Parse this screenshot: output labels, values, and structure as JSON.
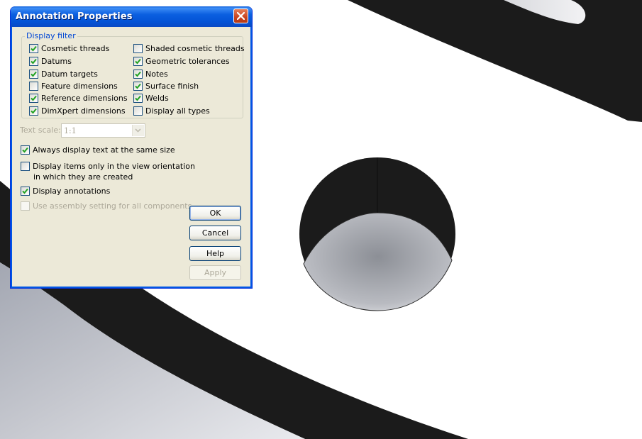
{
  "dialog": {
    "title": "Annotation Properties",
    "display_filter_label": "Display filter",
    "filters": [
      {
        "label": "Cosmetic threads",
        "checked": true
      },
      {
        "label": "Shaded cosmetic threads",
        "checked": false
      },
      {
        "label": "Datums",
        "checked": true
      },
      {
        "label": "Geometric tolerances",
        "checked": true
      },
      {
        "label": "Datum targets",
        "checked": true
      },
      {
        "label": "Notes",
        "checked": true
      },
      {
        "label": "Feature dimensions",
        "checked": false
      },
      {
        "label": "Surface finish",
        "checked": true
      },
      {
        "label": "Reference dimensions",
        "checked": true
      },
      {
        "label": "Welds",
        "checked": true
      },
      {
        "label": "DimXpert dimensions",
        "checked": true
      },
      {
        "label": "Display all types",
        "checked": false
      }
    ],
    "text_scale_label": "Text scale:",
    "text_scale_value": "1:1",
    "options": {
      "same_size": {
        "label": "Always display text at the same size",
        "checked": true
      },
      "view_orientation": {
        "label_line1": "Display items only in the view orientation",
        "label_line2": "in which they are created",
        "checked": false
      },
      "display_annotations": {
        "label": "Display annotations",
        "checked": true
      },
      "assembly_setting": {
        "label": "Use assembly setting for all components",
        "checked": false,
        "disabled": true
      }
    },
    "buttons": {
      "ok": "OK",
      "cancel": "Cancel",
      "help": "Help",
      "apply": "Apply"
    }
  },
  "colors": {
    "dialog_bg": "#ece9d8",
    "title_blue": "#0055e5",
    "legend_blue": "#0046d5",
    "check_green": "#21a121",
    "disabled_text": "#aca899",
    "model_dark": "#1a1a1a"
  }
}
